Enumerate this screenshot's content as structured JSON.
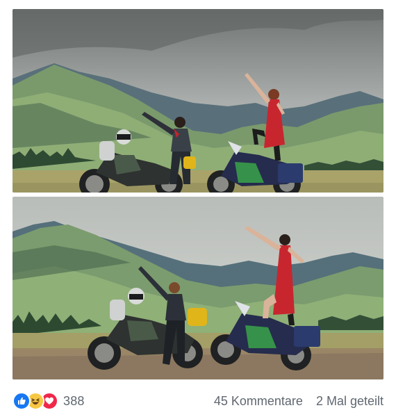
{
  "post": {
    "photos": [
      {
        "name": "photo-top",
        "subject": "two motorcycles with riders posing on a mountain meadow"
      },
      {
        "name": "photo-bottom",
        "subject": "recreated pose with two motorcycles on a dirt road"
      }
    ]
  },
  "footer": {
    "reaction_icons": [
      "like-icon",
      "haha-icon",
      "love-icon"
    ],
    "reaction_count": "388",
    "comments": "45 Kommentare",
    "shares": "2 Mal geteilt"
  },
  "colors": {
    "like": "#1877f2",
    "haha": "#f7c844",
    "love": "#f0284a",
    "meta_text": "#606770"
  }
}
